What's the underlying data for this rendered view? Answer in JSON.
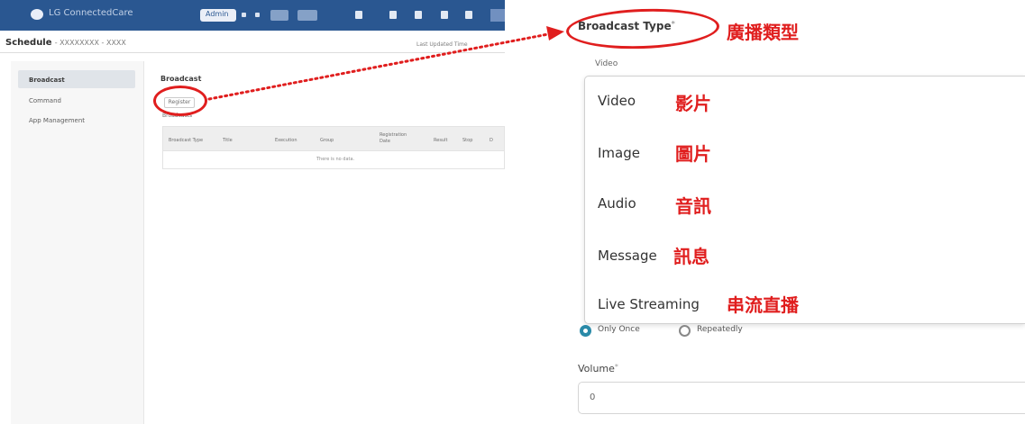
{
  "left_screen": {
    "app_title": "LG ConnectedCare",
    "admin_label": "Admin",
    "page_title": "Schedule",
    "page_subtitle": "- XXXXXXXX - XXXX",
    "header_right": "Last Updated Time",
    "sidebar": {
      "items": [
        {
          "label": "Broadcast"
        },
        {
          "label": "Command"
        },
        {
          "label": "App Management"
        }
      ]
    },
    "panel_title": "Broadcast",
    "register_label": "Register",
    "list_label": "Broadcasts",
    "table": {
      "headers": [
        "Broadcast Type",
        "Title",
        "Execution",
        "Group",
        "Registration Date",
        "Result",
        "Stop",
        "D"
      ],
      "empty_text": "There is no data."
    }
  },
  "right_panel": {
    "field_label": "Broadcast Type",
    "field_required": "*",
    "field_label_zh": "廣播類型",
    "selected_value": "Video",
    "options": [
      {
        "label": "Video",
        "zh": "影片"
      },
      {
        "label": "Image",
        "zh": "圖片"
      },
      {
        "label": "Audio",
        "zh": "音訊"
      },
      {
        "label": "Message",
        "zh": "訊息"
      },
      {
        "label": "Live Streaming",
        "zh": "串流直播"
      }
    ],
    "repeat_options": [
      {
        "label": "Only Once",
        "checked": true
      },
      {
        "label": "Repeatedly",
        "checked": false
      }
    ],
    "volume_label": "Volume",
    "volume_required": "*",
    "volume_value": "0"
  },
  "colors": {
    "accent_red": "#e01e1e",
    "topbar_blue": "#1f4e8c",
    "radio_teal": "#2a8aa8"
  }
}
